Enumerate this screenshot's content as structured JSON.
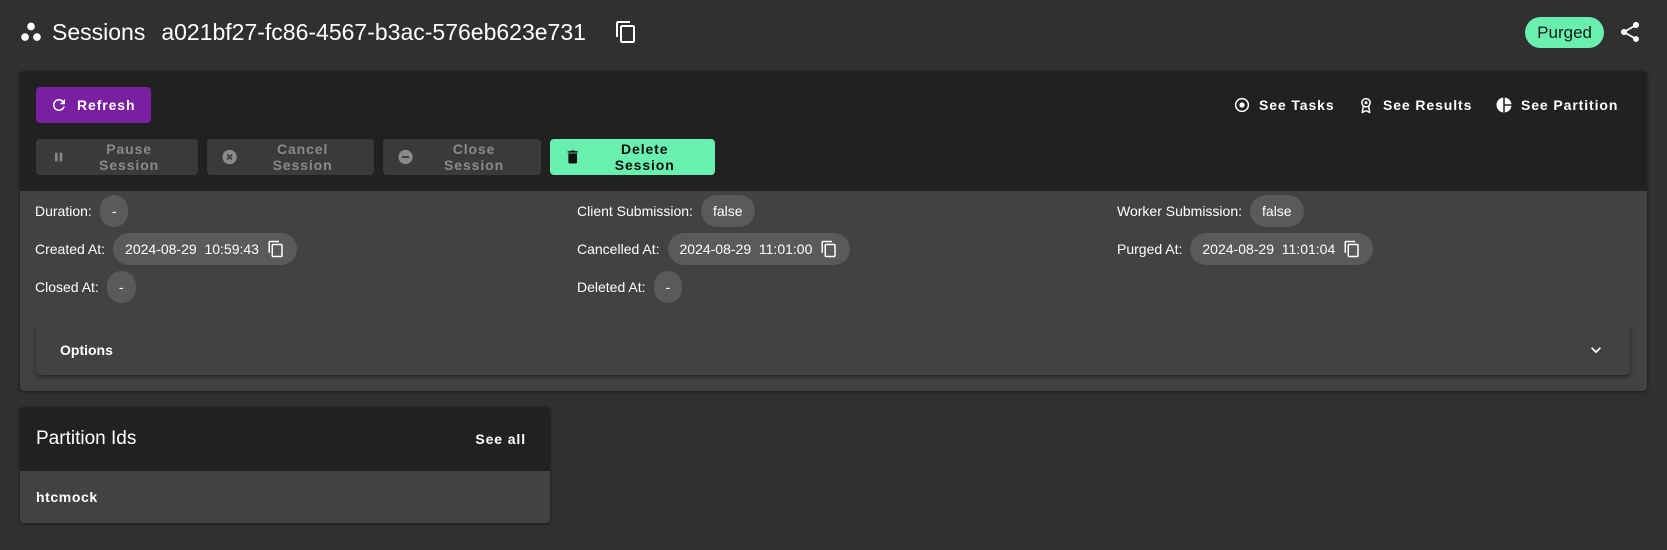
{
  "header": {
    "title": "Sessions",
    "session_id": "a021bf27-fc86-4567-b3ac-576eb623e731",
    "status": "Purged",
    "status_color": "#69f0ae"
  },
  "toolbar": {
    "refresh_label": "Refresh",
    "see_tasks_label": "See Tasks",
    "see_results_label": "See Results",
    "see_partition_label": "See Partition",
    "pause_label": "Pause Session",
    "cancel_label": "Cancel Session",
    "close_label": "Close Session",
    "delete_label": "Delete Session",
    "accent": "#7b1fa2"
  },
  "details": {
    "duration": {
      "label": "Duration:",
      "value": "-"
    },
    "created_at": {
      "label": "Created At:",
      "value": "2024-08-29  10:59:43"
    },
    "closed_at": {
      "label": "Closed At:",
      "value": "-"
    },
    "client_submission": {
      "label": "Client Submission:",
      "value": "false"
    },
    "cancelled_at": {
      "label": "Cancelled At:",
      "value": "2024-08-29  11:01:00"
    },
    "deleted_at": {
      "label": "Deleted At:",
      "value": "-"
    },
    "worker_submission": {
      "label": "Worker Submission:",
      "value": "false"
    },
    "purged_at": {
      "label": "Purged At:",
      "value": "2024-08-29  11:01:04"
    }
  },
  "options": {
    "title": "Options"
  },
  "partitions": {
    "title": "Partition Ids",
    "see_all_label": "See all",
    "items": [
      "htcmock"
    ]
  }
}
